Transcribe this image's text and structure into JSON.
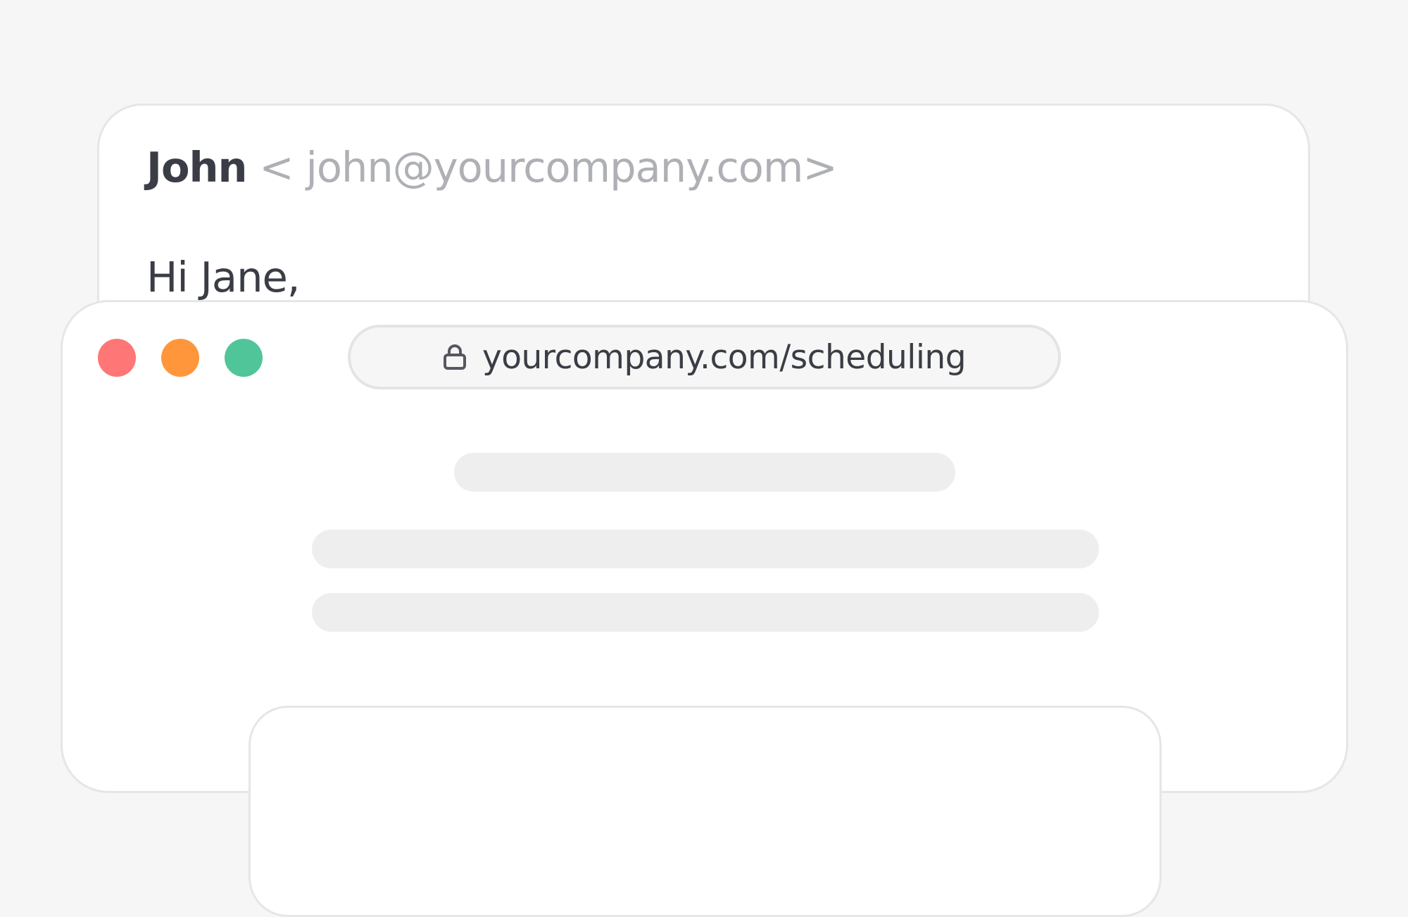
{
  "email": {
    "sender_name": "John",
    "sender_address": "< john@yourcompany.com>",
    "greeting": "Hi Jane,"
  },
  "browser": {
    "url": "yourcompany.com/scheduling",
    "traffic_lights": {
      "close_color": "#ff7676",
      "minimize_color": "#ff963b",
      "maximize_color": "#50c59a"
    },
    "address_bar_icon": "lock-icon"
  },
  "colors": {
    "background": "#f6f6f6",
    "card_border": "#e6e6e6",
    "text_dark": "#3a3d45",
    "text_muted": "#aeb0b5",
    "skeleton": "#eeeeee"
  }
}
